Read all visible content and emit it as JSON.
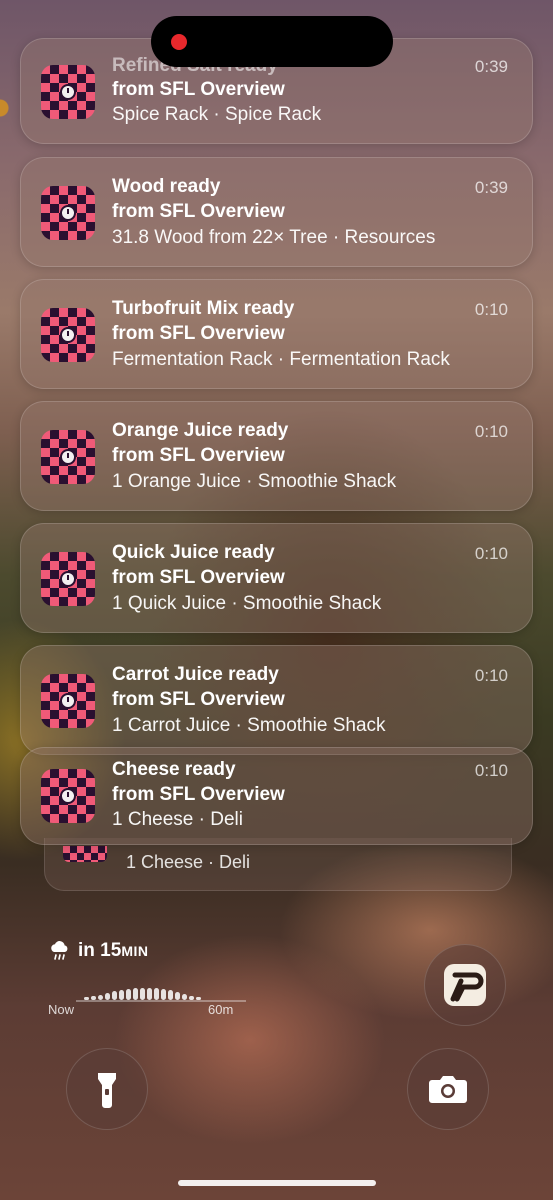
{
  "status": {
    "recording_indicator": "red-dot"
  },
  "notifications": [
    {
      "title": "Refined Salt ready",
      "source": "from SFL Overview",
      "detail": "Spice Rack · Spice Rack",
      "time": "0:39"
    },
    {
      "title": "Wood ready",
      "source": "from SFL Overview",
      "detail": "31.8 Wood from 22× Tree · Resources",
      "time": "0:39"
    },
    {
      "title": "Turbofruit Mix ready",
      "source": "from SFL Overview",
      "detail": "Fermentation Rack · Fermentation Rack",
      "time": "0:10"
    },
    {
      "title": "Orange Juice ready",
      "source": "from SFL Overview",
      "detail": "1 Orange Juice · Smoothie Shack",
      "time": "0:10"
    },
    {
      "title": "Quick Juice ready",
      "source": "from SFL Overview",
      "detail": "1 Quick Juice · Smoothie Shack",
      "time": "0:10"
    },
    {
      "title": "Carrot Juice ready",
      "source": "from SFL Overview",
      "detail": "1 Carrot Juice · Smoothie Shack",
      "time": "0:10"
    },
    {
      "title": "Cheese ready",
      "source": "from SFL Overview",
      "detail": "1 Cheese · Deli",
      "time": "0:10"
    }
  ],
  "stacked_notification": {
    "detail": "1 Cheese · Deli"
  },
  "weather": {
    "icon": "rain-cloud-icon",
    "prefix": "in 15",
    "unit": "MIN",
    "start_label": "Now",
    "end_label": "60m"
  },
  "buttons": {
    "flashlight_icon": "flashlight-icon",
    "camera_icon": "camera-icon",
    "widget_icon": "p-app-icon"
  }
}
